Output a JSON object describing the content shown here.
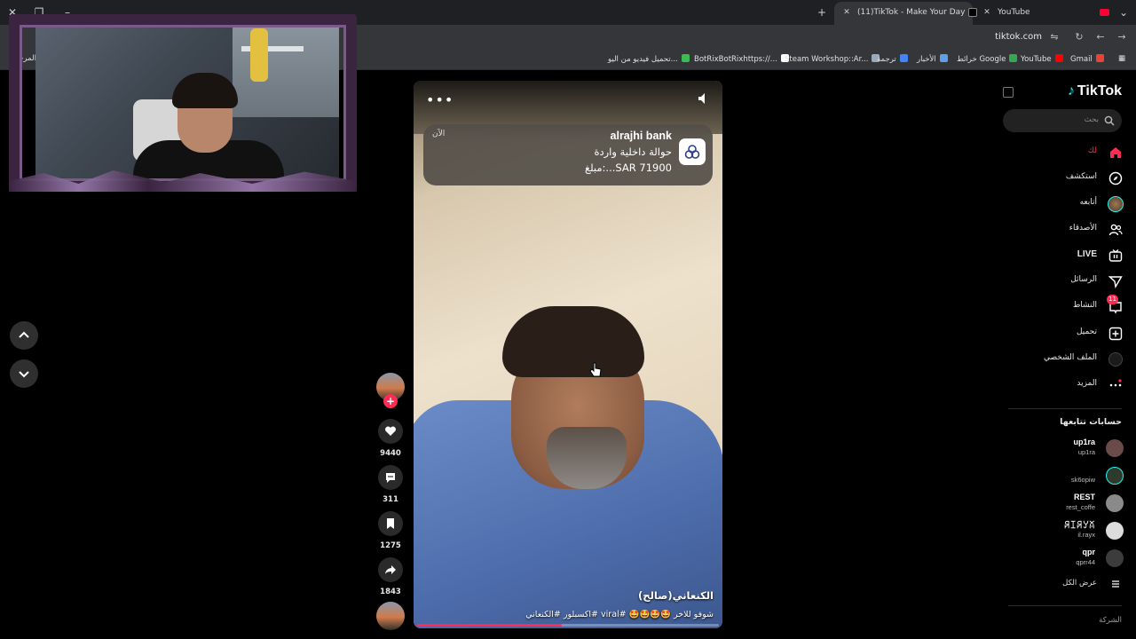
{
  "browser": {
    "tabs": [
      {
        "title": "(11)TikTok - Make Your Day",
        "active": true
      },
      {
        "title": "YouTube",
        "active": false
      }
    ],
    "url": "tiktok.com",
    "bookmarks": [
      {
        "label": "المرجعية"
      },
      {
        "label": "تحميل فيديو من اليو...",
        "color": "#3cba54"
      },
      {
        "label": "BotRixBotRixhttps://...",
        "color": "#ffffff"
      },
      {
        "label": "Steam Workshop::Ar...",
        "color": "#1b2838"
      },
      {
        "label": "ترجمة",
        "color": "#4285f4"
      },
      {
        "label": "الأخبار",
        "color": "#5f9ee8"
      },
      {
        "label": "خرائط Google",
        "color": "#34a853"
      },
      {
        "label": "YouTube",
        "color": "#ff0000"
      },
      {
        "label": "Gmail",
        "color": "#ea4335"
      }
    ]
  },
  "video": {
    "notification": {
      "app": "alrajhi bank",
      "time": "الآن",
      "line1": "حوالة داخلية واردة",
      "line2": "مبلغ:...SAR 71900"
    },
    "author": "الكنعاني(صالح)",
    "caption": "شوفو للاخر 🤩🤩🤩🤩 #viral #اكسبلور #الكنعاني",
    "progress": 0.48,
    "accent": "#fe2c55"
  },
  "actions": {
    "likes": "9440",
    "comments": "311",
    "saves": "1275",
    "shares": "1843"
  },
  "sidebar": {
    "logo": "TikTok",
    "search_placeholder": "بحث",
    "nav": [
      {
        "label": "لك",
        "icon": "home-icon"
      },
      {
        "label": "استكشف",
        "icon": "compass-icon"
      },
      {
        "label": "أتابعه",
        "icon": "following-avatar-icon"
      },
      {
        "label": "الأصدقاء",
        "icon": "friends-icon"
      },
      {
        "label": "LIVE",
        "icon": "live-icon"
      },
      {
        "label": "الرسائل",
        "icon": "send-icon"
      },
      {
        "label": "النشاط",
        "icon": "activity-icon",
        "badge": "11"
      },
      {
        "label": "تحميل",
        "icon": "upload-icon"
      },
      {
        "label": "الملف الشخصي",
        "icon": "profile-icon"
      },
      {
        "label": "المزيد",
        "icon": "more-icon"
      }
    ],
    "following_heading": "حسابات تتابعها",
    "following": [
      {
        "name": "up1ra",
        "handle": "up1ra",
        "color": "#6b4a4a"
      },
      {
        "name": "",
        "handle": "sk6opiw",
        "color": "#2e3a2c"
      },
      {
        "name": "REST",
        "handle": "rest_coffe",
        "color": "#8a8a8a"
      },
      {
        "name": "ꋪꀤꋪꌦꊼ",
        "handle": "il.rayx",
        "color": "#dcdcdc"
      },
      {
        "name": "qpr",
        "handle": "qprr44",
        "color": "#3c3c3c"
      }
    ],
    "see_all": "عرض الكل",
    "company": "الشركة"
  }
}
